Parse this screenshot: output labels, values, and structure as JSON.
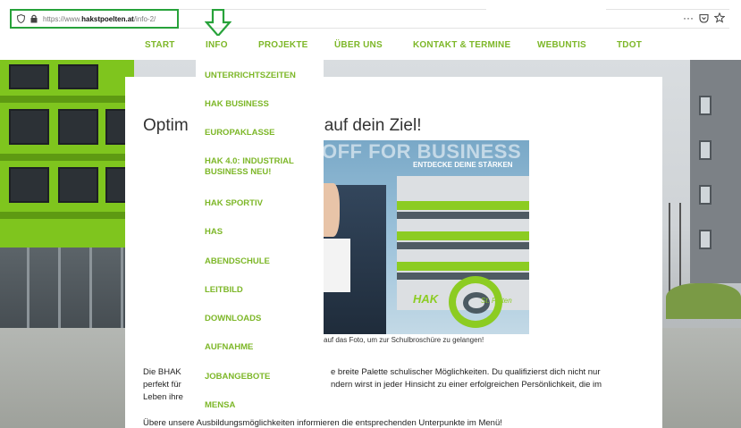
{
  "browser": {
    "url_prefix": "https://www.",
    "url_domain": "hakstpoelten.at",
    "url_path": "/info-2/",
    "menu_glyph": "···",
    "icons": [
      "shield-icon",
      "lock-icon",
      "pocket-icon",
      "star-icon"
    ]
  },
  "nav": {
    "items": [
      "START",
      "INFO",
      "PROJEKTE",
      "ÜBER UNS",
      "KONTAKT & TERMINE",
      "WEBUNTIS",
      "TDOT"
    ]
  },
  "dropdown": {
    "items": [
      "UNTERRICHTSZEITEN",
      "HAK BUSINESS",
      "EUROPAKLASSE",
      "HAK 4.0: INDUSTRIAL BUSINESS NEU!",
      "HAK SPORTIV",
      "HAS",
      "ABENDSCHULE",
      "LEITBILD",
      "DOWNLOADS",
      "AUFNAHME",
      "JOBANGEBOTE",
      "MENSA"
    ]
  },
  "content": {
    "headline_left": "Optim",
    "headline_right": "auf dein Ziel!",
    "promo_title": "OFF FOR BUSINESS",
    "promo_subtitle": "ENTDECKE DEINE STÄRKEN",
    "promo_logo_hak": "HAK",
    "promo_logo_city": "St. Pölten",
    "caption": "auf das Foto, um zur Schulbroschüre zu gelangen!",
    "body_l1_left": "Die BHAK",
    "body_l1_right": "e breite Palette schulischer Möglichkeiten. Du qualifizierst dich nicht nur",
    "body_l2_left": "perfekt für",
    "body_l2_right": "ndern wirst in jeder Hinsicht zu einer erfolgreichen Persönlichkeit, die im",
    "body_l3_left": "Leben ihre",
    "bottom_line": "Übere unsere Ausbildungsmöglichkeiten informieren die entsprechenden Unterpunkte im Menü!"
  },
  "colors": {
    "accent_green": "#7db728",
    "highlight_border": "#27a23a"
  }
}
